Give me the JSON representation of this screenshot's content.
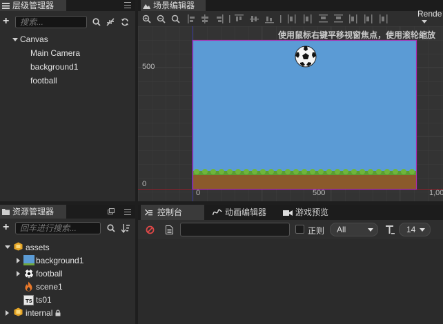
{
  "hierarchy": {
    "tab_label": "层级管理器",
    "search_placeholder": "搜索...",
    "nodes": [
      {
        "label": "Canvas"
      },
      {
        "label": "Main Camera"
      },
      {
        "label": "background1"
      },
      {
        "label": "football"
      }
    ]
  },
  "scene": {
    "tab_label": "场景编辑器",
    "hint": "使用鼠标右键平移视窗焦点，使用滚轮缩放",
    "render_dropdown": "Rende",
    "axis": {
      "y500": "500",
      "y0": "0",
      "x0": "0",
      "x500": "500",
      "x1000": "1,00"
    },
    "colors": {
      "sky": "#5b9bd5",
      "grass": "#5a9e32",
      "dirt": "#8b5a2b",
      "frame": "#b02ab0"
    }
  },
  "assets": {
    "tab_label": "资源管理器",
    "search_placeholder": "回车进行搜索...",
    "items": [
      {
        "label": "assets",
        "icon": "folder-icon"
      },
      {
        "label": "background1",
        "icon": "image-icon"
      },
      {
        "label": "football",
        "icon": "ball-icon"
      },
      {
        "label": "scene1",
        "icon": "fire-icon"
      },
      {
        "label": "ts01",
        "icon": "typescript-icon"
      },
      {
        "label": "internal",
        "icon": "folder-icon"
      }
    ]
  },
  "bottom": {
    "tabs": [
      {
        "label": "控制台"
      },
      {
        "label": "动画编辑器"
      },
      {
        "label": "游戏预览"
      }
    ],
    "regex_label": "正则",
    "level_select": "All",
    "font_size": "14"
  }
}
